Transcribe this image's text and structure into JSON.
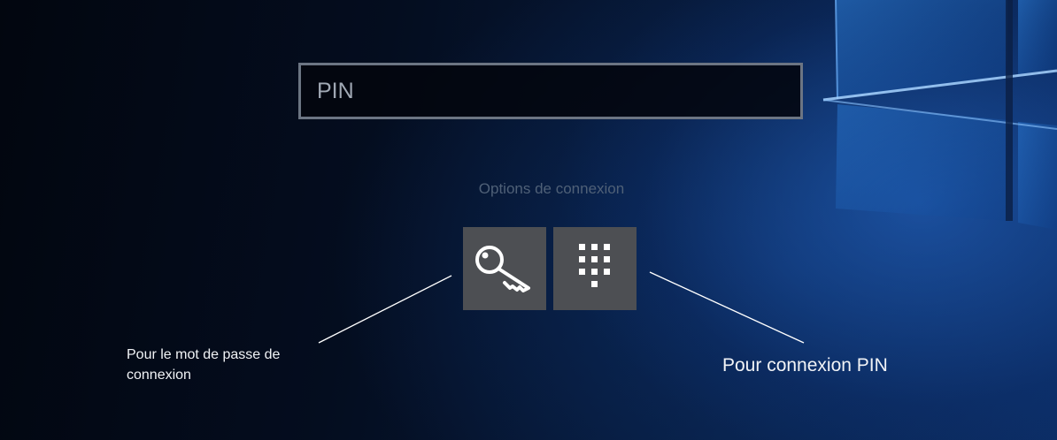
{
  "pin_field": {
    "placeholder": "PIN",
    "value": ""
  },
  "sign_in_options": {
    "label": "Options de connexion",
    "options": [
      {
        "name": "password",
        "icon": "key-icon"
      },
      {
        "name": "pin",
        "icon": "keypad-icon"
      }
    ]
  },
  "annotations": {
    "password": "Pour le mot de passe de connexion",
    "pin": "Pour connexion PIN"
  },
  "colors": {
    "tile": "#4d4f53",
    "field_border": "#6c7583",
    "annotation_line": "#ffffff"
  }
}
